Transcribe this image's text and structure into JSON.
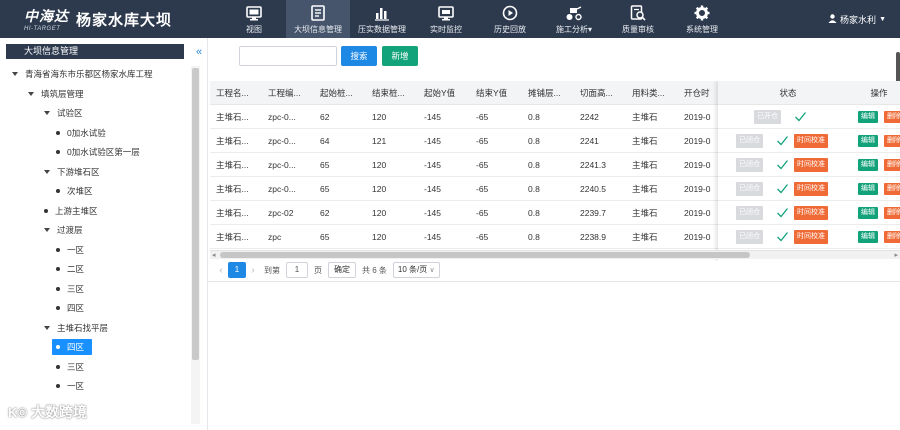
{
  "header": {
    "logo_main": "中海达",
    "logo_sub": "HI-TARGET",
    "title": "杨家水库大坝",
    "user": "杨家水利",
    "nav": [
      {
        "label": "视图",
        "icon": "monitor-icon"
      },
      {
        "label": "大坝信息管理",
        "icon": "document-icon"
      },
      {
        "label": "压实数据管理",
        "icon": "bar-chart-icon"
      },
      {
        "label": "实时监控",
        "icon": "monitor-display-icon"
      },
      {
        "label": "历史回放",
        "icon": "play-circle-icon"
      },
      {
        "label": "施工分析▾",
        "icon": "roller-icon"
      },
      {
        "label": "质量审核",
        "icon": "audit-icon"
      },
      {
        "label": "系统管理",
        "icon": "gear-icon"
      }
    ],
    "active_index": 1
  },
  "sidebar": {
    "title": "大坝信息管理",
    "collapse_icon": "«",
    "tree": [
      {
        "label": "青海省海东市乐都区杨家水库工程",
        "kind": "caret",
        "level": 0
      },
      {
        "label": "填筑层管理",
        "kind": "caret",
        "level": 1
      },
      {
        "label": "试验区",
        "kind": "caret",
        "level": 2
      },
      {
        "label": "0加水试验",
        "kind": "dot",
        "level": 3
      },
      {
        "label": "0加水试验区第一层",
        "kind": "dot",
        "level": 3
      },
      {
        "label": "下游堆石区",
        "kind": "caret",
        "level": 2
      },
      {
        "label": "次堆区",
        "kind": "dot",
        "level": 3
      },
      {
        "label": "上游主堆区",
        "kind": "dot",
        "level": 2
      },
      {
        "label": "过渡层",
        "kind": "caret",
        "level": 2
      },
      {
        "label": "一区",
        "kind": "dot",
        "level": 3
      },
      {
        "label": "二区",
        "kind": "dot",
        "level": 3
      },
      {
        "label": "三区",
        "kind": "dot",
        "level": 3
      },
      {
        "label": "四区",
        "kind": "dot",
        "level": 3
      },
      {
        "label": "主堆石找平层",
        "kind": "caret",
        "level": 2
      },
      {
        "label": "四区",
        "kind": "dot",
        "level": 3,
        "selected": true
      },
      {
        "label": "三区",
        "kind": "dot",
        "level": 3
      },
      {
        "label": "一区",
        "kind": "dot",
        "level": 3
      }
    ]
  },
  "watermark": "大数跨境",
  "toolbar": {
    "search_placeholder": "",
    "search_label": "搜索",
    "add_label": "新增"
  },
  "table": {
    "columns": [
      "工程名...",
      "工程编...",
      "起始桩...",
      "结束桩...",
      "起始Y值",
      "结束Y值",
      "摊铺层...",
      "切面高...",
      "用料类...",
      "开仓时",
      "状态",
      "操作"
    ],
    "rows": [
      [
        "主堆石...",
        "zpc-0...",
        "62",
        "120",
        "-145",
        "-65",
        "0.8",
        "2242",
        "主堆石",
        "2019-0"
      ],
      [
        "主堆石...",
        "zpc-0...",
        "64",
        "121",
        "-145",
        "-65",
        "0.8",
        "2241",
        "主堆石",
        "2019-0"
      ],
      [
        "主堆石...",
        "zpc-0...",
        "65",
        "120",
        "-145",
        "-65",
        "0.8",
        "2241.3",
        "主堆石",
        "2019-0"
      ],
      [
        "主堆石...",
        "zpc-0...",
        "65",
        "120",
        "-145",
        "-65",
        "0.8",
        "2240.5",
        "主堆石",
        "2019-0"
      ],
      [
        "主堆石...",
        "zpc-02",
        "62",
        "120",
        "-145",
        "-65",
        "0.8",
        "2239.7",
        "主堆石",
        "2019-0"
      ],
      [
        "主堆石...",
        "zpc",
        "65",
        "120",
        "-145",
        "-65",
        "0.8",
        "2238.9",
        "主堆石",
        "2019-0"
      ]
    ],
    "status_labels": [
      "已开仓",
      "已闭仓",
      "已闭仓",
      "已闭仓",
      "已闭仓",
      "已闭仓"
    ],
    "adjust_label": "时间校准",
    "edit_label": "编辑",
    "delete_label": "删除"
  },
  "pagination": {
    "current_page": "1",
    "goto_label": "到第",
    "goto_value": "1",
    "page_suffix": "页",
    "confirm_label": "确定",
    "total": "共 6 条",
    "page_size": "10 条/页"
  }
}
